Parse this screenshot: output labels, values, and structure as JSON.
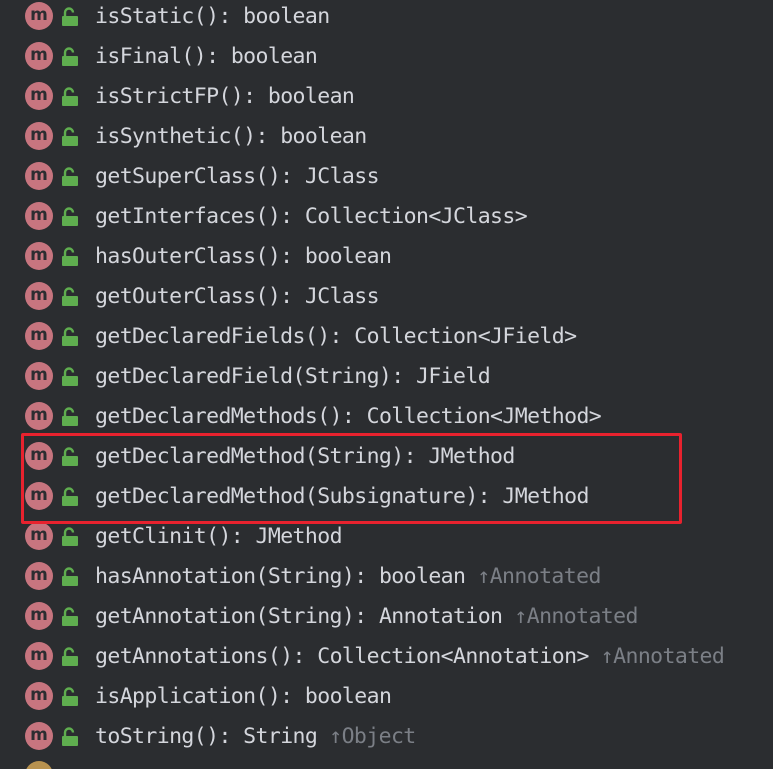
{
  "members": [
    {
      "name": "isStatic()",
      "type": "boolean",
      "inherited": ""
    },
    {
      "name": "isFinal()",
      "type": "boolean",
      "inherited": ""
    },
    {
      "name": "isStrictFP()",
      "type": "boolean",
      "inherited": ""
    },
    {
      "name": "isSynthetic()",
      "type": "boolean",
      "inherited": ""
    },
    {
      "name": "getSuperClass()",
      "type": "JClass",
      "inherited": ""
    },
    {
      "name": "getInterfaces()",
      "type": "Collection<JClass>",
      "inherited": ""
    },
    {
      "name": "hasOuterClass()",
      "type": "boolean",
      "inherited": ""
    },
    {
      "name": "getOuterClass()",
      "type": "JClass",
      "inherited": ""
    },
    {
      "name": "getDeclaredFields()",
      "type": "Collection<JField>",
      "inherited": ""
    },
    {
      "name": "getDeclaredField(String)",
      "type": "JField",
      "inherited": ""
    },
    {
      "name": "getDeclaredMethods()",
      "type": "Collection<JMethod>",
      "inherited": ""
    },
    {
      "name": "getDeclaredMethod(String)",
      "type": "JMethod",
      "inherited": ""
    },
    {
      "name": "getDeclaredMethod(Subsignature)",
      "type": "JMethod",
      "inherited": ""
    },
    {
      "name": "getClinit()",
      "type": "JMethod",
      "inherited": ""
    },
    {
      "name": "hasAnnotation(String)",
      "type": "boolean",
      "inherited": "↑Annotated"
    },
    {
      "name": "getAnnotation(String)",
      "type": "Annotation",
      "inherited": "↑Annotated"
    },
    {
      "name": "getAnnotations()",
      "type": "Collection<Annotation>",
      "inherited": "↑Annotated"
    },
    {
      "name": "isApplication()",
      "type": "boolean",
      "inherited": ""
    },
    {
      "name": "toString()",
      "type": "String",
      "inherited": "↑Object"
    }
  ],
  "method_icon_letter": "m",
  "icons": {
    "method": "method-m-icon",
    "visibility": "public-lock-icon"
  },
  "colors": {
    "background": "#2b2d30",
    "method_icon": "#c7757f",
    "lock": "#5fae4f",
    "text": "#d4d6dc",
    "inherited": "#7b7f86",
    "highlight": "#e8222e"
  }
}
